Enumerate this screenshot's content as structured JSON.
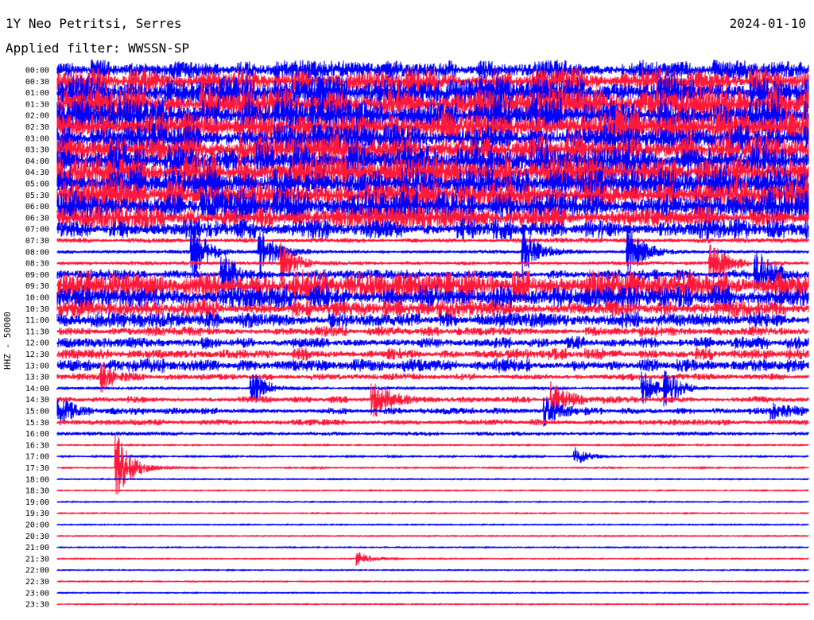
{
  "header": {
    "station": "1Y Neo Petritsi, Serres",
    "date": "2024-01-10",
    "filter": "Applied filter: WWSSN-SP"
  },
  "colors": {
    "blue": "#0000ff",
    "red": "#ff1a3c"
  },
  "chart_data": {
    "type": "line",
    "title": "1Y Neo Petritsi, Serres",
    "subtitle": "Applied filter: WWSSN-SP",
    "date": "2024-01-10",
    "ylabel": "HHZ - 50000",
    "xlabel": "",
    "grid": false,
    "series_colors": [
      "#0000ff",
      "#ff1a3c"
    ],
    "row_labels": [
      "00:00",
      "00:30",
      "01:00",
      "01:30",
      "02:00",
      "02:30",
      "03:00",
      "03:30",
      "04:00",
      "04:30",
      "05:00",
      "05:30",
      "06:00",
      "06:30",
      "07:00",
      "07:30",
      "08:00",
      "08:30",
      "09:00",
      "09:30",
      "10:00",
      "10:30",
      "11:00",
      "11:30",
      "12:00",
      "12:30",
      "13:00",
      "13:30",
      "14:00",
      "14:30",
      "15:00",
      "15:30",
      "16:00",
      "16:30",
      "17:00",
      "17:30",
      "18:00",
      "18:30",
      "19:00",
      "19:30",
      "20:00",
      "20:30",
      "21:00",
      "21:30",
      "22:00",
      "22:30",
      "23:00",
      "23:30"
    ],
    "noise_amplitude": [
      0.55,
      0.75,
      0.95,
      1.0,
      1.0,
      1.0,
      0.85,
      0.9,
      0.95,
      1.0,
      1.0,
      1.0,
      0.9,
      0.7,
      0.6,
      0.15,
      0.12,
      0.12,
      0.3,
      0.9,
      0.7,
      0.55,
      0.45,
      0.3,
      0.35,
      0.35,
      0.4,
      0.2,
      0.08,
      0.2,
      0.2,
      0.18,
      0.12,
      0.04,
      0.05,
      0.04,
      0.03,
      0.03,
      0.03,
      0.03,
      0.03,
      0.03,
      0.02,
      0.03,
      0.02,
      0.02,
      0.02,
      0.02
    ],
    "events": [
      {
        "row": "08:00",
        "t": 0.18,
        "amp": 0.9
      },
      {
        "row": "08:00",
        "t": 0.27,
        "amp": 0.7
      },
      {
        "row": "08:00",
        "t": 0.62,
        "amp": 0.8
      },
      {
        "row": "08:00",
        "t": 0.76,
        "amp": 0.8
      },
      {
        "row": "08:30",
        "t": 0.3,
        "amp": 0.6
      },
      {
        "row": "08:30",
        "t": 0.87,
        "amp": 0.7
      },
      {
        "row": "09:00",
        "t": 0.22,
        "amp": 0.6
      },
      {
        "row": "09:00",
        "t": 0.93,
        "amp": 0.8
      },
      {
        "row": "13:30",
        "t": 0.06,
        "amp": 0.4
      },
      {
        "row": "14:00",
        "t": 0.26,
        "amp": 0.5
      },
      {
        "row": "14:00",
        "t": 0.78,
        "amp": 0.55
      },
      {
        "row": "14:00",
        "t": 0.81,
        "amp": 0.55
      },
      {
        "row": "14:30",
        "t": 0.42,
        "amp": 0.65
      },
      {
        "row": "14:30",
        "t": 0.66,
        "amp": 0.5
      },
      {
        "row": "15:00",
        "t": 0.0,
        "amp": 0.5
      },
      {
        "row": "15:00",
        "t": 0.65,
        "amp": 0.5
      },
      {
        "row": "15:00",
        "t": 0.95,
        "amp": 0.3
      },
      {
        "row": "17:00",
        "t": 0.69,
        "amp": 0.25
      },
      {
        "row": "17:30",
        "t": 0.08,
        "amp": 1.0
      },
      {
        "row": "21:30",
        "t": 0.4,
        "amp": 0.2
      }
    ]
  }
}
